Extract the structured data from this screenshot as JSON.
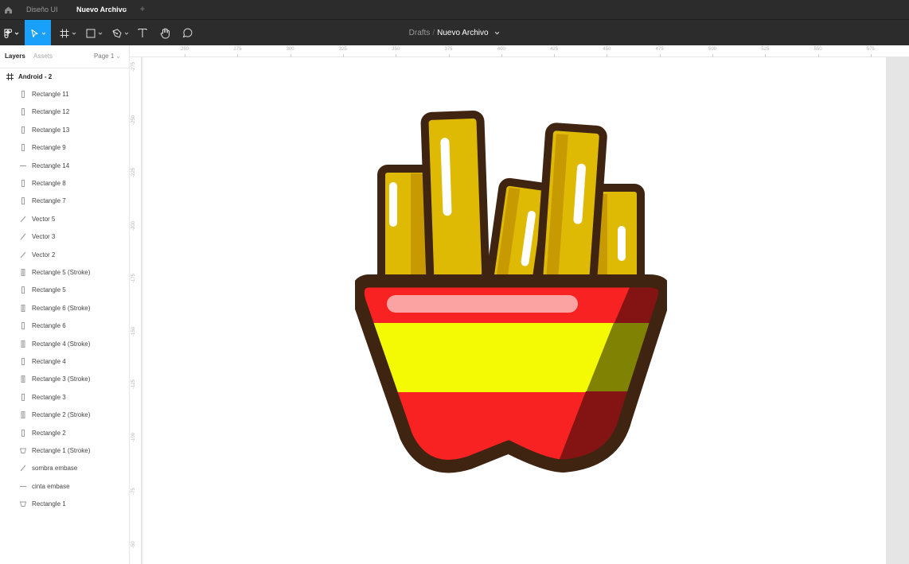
{
  "tabbar": {
    "tabs": [
      {
        "label": "Diseño UI",
        "active": false
      },
      {
        "label": "Nuevo Archivo",
        "active": true
      }
    ],
    "close_glyph": "×",
    "add_glyph": "+"
  },
  "toolbar": {
    "tools": [
      "main-menu-icon",
      "move-tool-icon",
      "frame-tool-icon",
      "rectangle-tool-icon",
      "pen-tool-icon",
      "text-tool-icon",
      "hand-tool-icon",
      "comment-tool-icon"
    ],
    "active_tool": "move-tool-icon",
    "accent": "#18a0fb",
    "breadcrumb": {
      "folder": "Drafts",
      "separator": "/",
      "file": "Nuevo Archivo"
    }
  },
  "left_panel": {
    "tabs": [
      "Layers",
      "Assets"
    ],
    "page_label": "Page 1",
    "frame_name": "Android - 2",
    "layers": [
      "Rectangle 11",
      "Rectangle 12",
      "Rectangle 13",
      "Rectangle 9",
      "Rectangle 14",
      "Rectangle 8",
      "Rectangle 7",
      "Vector 5",
      "Vector 3",
      "Vector 2",
      "Rectangle 5 (Stroke)",
      "Rectangle 5",
      "Rectangle 6 (Stroke)",
      "Rectangle 6",
      "Rectangle 4 (Stroke)",
      "Rectangle 4",
      "Rectangle 3 (Stroke)",
      "Rectangle 3",
      "Rectangle 2 (Stroke)",
      "Rectangle 2",
      "Rectangle 1 (Stroke)",
      "sombra embase",
      "cinta embase",
      "Rectangle 1"
    ]
  },
  "rulers": {
    "top_labels": [
      "250",
      "275",
      "300",
      "325",
      "350",
      "375",
      "400",
      "425",
      "450",
      "475",
      "500",
      "525",
      "550",
      "575"
    ],
    "left_labels": [
      "-275",
      "-250",
      "-225",
      "-200",
      "-175",
      "-150",
      "-125",
      "-100",
      "-75",
      "-50"
    ]
  },
  "artwork": {
    "colors": {
      "outline": "#3f2412",
      "fry_yellow": "#dfba05",
      "fry_shade": "#c79a02",
      "highlight": "#ffffff",
      "cup_red": "#f92222",
      "cup_yellow": "#f4f904",
      "cup_shadow_red": "#841414",
      "cup_shadow_yellow": "#7f8203",
      "cup_ribbon": "#fba3a3"
    }
  }
}
